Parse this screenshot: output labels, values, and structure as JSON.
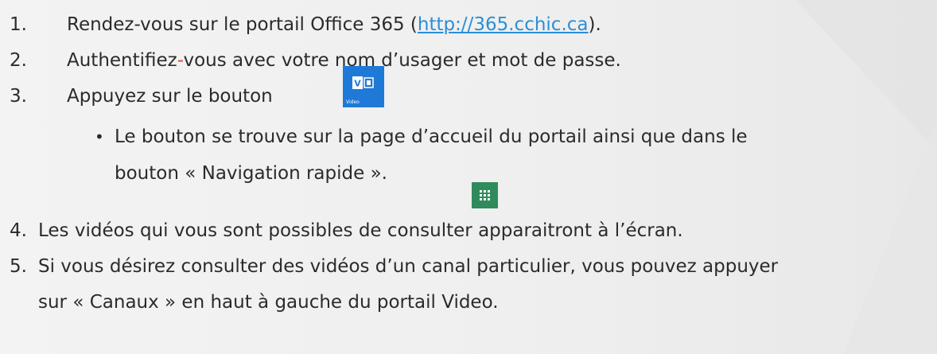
{
  "steps": [
    {
      "number": "1.",
      "before_link": "Rendez-vous sur le portail Office 365 (",
      "link": "http://365.cchic.ca",
      "after_link": ")."
    },
    {
      "number": "2.",
      "part1": "Authentifiez",
      "dash": "-",
      "part2": "vous avec votre nom d’usager et mot de passe."
    },
    {
      "number": "3.",
      "text": "Appuyez sur le bouton"
    },
    {
      "number": "4.",
      "text": "Les vidéos qui vous sont possibles de consulter apparaitront à l’écran."
    },
    {
      "number": "5.",
      "line1": "Si vous désirez consulter des vidéos d’un canal particulier, vous pouvez appuyer",
      "line2": "sur « Canaux » en haut à gauche du portail Video."
    }
  ],
  "sub_bullet": {
    "line1": "Le bouton se trouve sur la page d’accueil du portail ainsi que dans le",
    "line2": "bouton « Navigation rapide »."
  },
  "video_button": {
    "caption": "Video",
    "icon": "video-icon",
    "color": "#1e7ad6"
  },
  "nav_button": {
    "icon": "app-launcher-icon",
    "color": "#2f8b5c"
  },
  "colors": {
    "link": "#2a8fd8",
    "dash": "#d44a2e",
    "text": "#2b2b2b"
  }
}
